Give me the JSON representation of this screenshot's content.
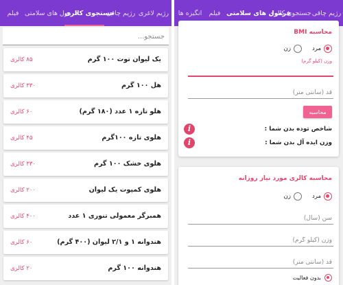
{
  "colors": {
    "primary": "#7d3ad1",
    "accent": "#e2456c",
    "button": "#f06292"
  },
  "left_tabs": [
    {
      "label": "فیلم"
    },
    {
      "label": "فرمول های سلامتی"
    },
    {
      "label": "جستجوی کالری"
    },
    {
      "label": "رژیم چاقی"
    },
    {
      "label": "رژیم لاغری"
    }
  ],
  "right_tabs": [
    {
      "label": "انگیزه ها"
    },
    {
      "label": "فیلم"
    },
    {
      "label": "فرمول های سلامتی"
    },
    {
      "label": "جستجوی کالری"
    },
    {
      "label": "رژیم چاقی"
    }
  ],
  "search": {
    "placeholder": "جستجو..."
  },
  "foods": [
    {
      "name": "یک لیوان توت ۱۰۰ گرم",
      "calories": "۸۵ کالری"
    },
    {
      "name": "هل ۱۰۰ گرم",
      "calories": "۳۳۰ کالری"
    },
    {
      "name": "هلو تازه ۱ عدد (۱۸۰ گرم)",
      "calories": "۶۰ کالری"
    },
    {
      "name": "هلوی تازه ۱۰۰گرم",
      "calories": "۴۵ کالری"
    },
    {
      "name": "هلوی خشک ۱۰۰ گرم",
      "calories": "۳۳۰ کالری"
    },
    {
      "name": "هلوی کمپوت یک لیوان",
      "calories": "۲۰۰ کالری"
    },
    {
      "name": "همبرگر معمولی تنوری ۱ عدد",
      "calories": "۴۰۰ کالری"
    },
    {
      "name": "هندوانه ۱ و ۲/۱ لیوان (۴۰۰ گرم)",
      "calories": "۶۰ کالری"
    },
    {
      "name": "هندوانه ۱۰۰ گرم",
      "calories": "۲۰ کالری"
    }
  ],
  "bmi": {
    "title": "محاسبه BMI",
    "gender_options": [
      {
        "label": "مرد",
        "selected": true
      },
      {
        "label": "زن",
        "selected": false
      }
    ],
    "weight_label": "وزن (کیلو گرم)",
    "height_placeholder": "قد (سانتی متر)",
    "button_label": "محاسبه",
    "bmi_result_label": "شاخص توده بدن شما :",
    "ideal_weight_label": "وزن ایده آل بدن شما :"
  },
  "daily_calorie": {
    "title": "محاسبه کالری مورد نیاز روزانه",
    "gender_options": [
      {
        "label": "مرد",
        "selected": true
      },
      {
        "label": "زن",
        "selected": false
      }
    ],
    "age_placeholder": "سن (سال)",
    "weight_placeholder": "وزن (کیلو گرم)",
    "height_placeholder": "قد (سانتی متر)",
    "activity_label": "بدون فعالیت"
  }
}
